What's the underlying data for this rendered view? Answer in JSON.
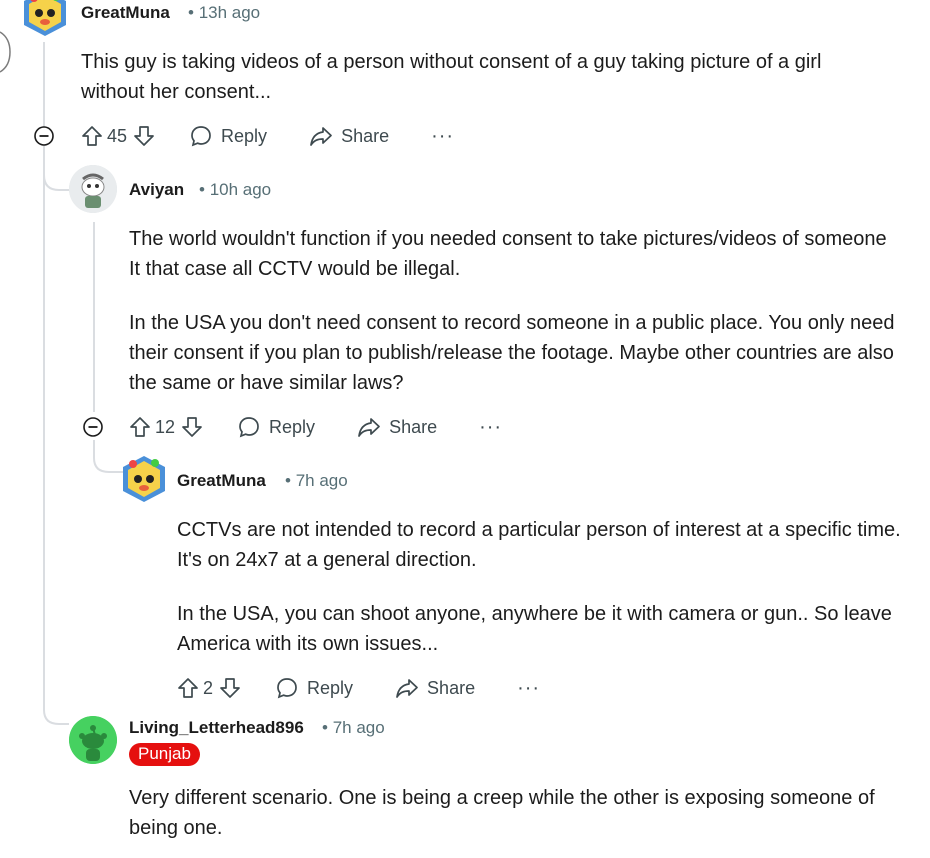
{
  "colors": {
    "flair_bg": "#e5100f",
    "meta": "#576f76",
    "thread_line": "#dadde1"
  },
  "comments": [
    {
      "username": "GreatMuna",
      "time": "13h ago",
      "avatar": "snoo-avatar-greatmuna",
      "lines": [
        "This guy is taking videos of a person without consent of a guy taking picture of a girl",
        "without her consent..."
      ],
      "votes": "45",
      "reply_label": "Reply",
      "share_label": "Share",
      "more_label": "···"
    },
    {
      "username": "Aviyan",
      "time": "10h ago",
      "avatar": "snoo-avatar-aviyan",
      "lines": [
        "The world wouldn't function if you needed consent to take pictures/videos of someone",
        "It that case all CCTV would be illegal."
      ],
      "lines2": [
        "In the USA you don't need consent to record someone in a public place. You only need",
        "their consent if you plan to publish/release the footage. Maybe other countries are also",
        "the same or have similar laws?"
      ],
      "votes": "12",
      "reply_label": "Reply",
      "share_label": "Share",
      "more_label": "···"
    },
    {
      "username": "GreatMuna",
      "time": "7h ago",
      "avatar": "snoo-avatar-greatmuna",
      "lines": [
        "CCTVs are not intended to record a particular person of interest at a specific time.",
        "It's on 24x7 at a general direction."
      ],
      "lines2": [
        "In the USA, you can shoot anyone, anywhere be it with camera or gun.. So leave",
        "America with its own issues..."
      ],
      "votes": "2",
      "reply_label": "Reply",
      "share_label": "Share",
      "more_label": "···"
    },
    {
      "username": "Living_Letterhead896",
      "time": "7h ago",
      "avatar": "snoo-avatar-default-green",
      "flair": "Punjab",
      "lines": [
        "Very different scenario. One is being a creep while the other is exposing someone of",
        "being one."
      ]
    }
  ]
}
